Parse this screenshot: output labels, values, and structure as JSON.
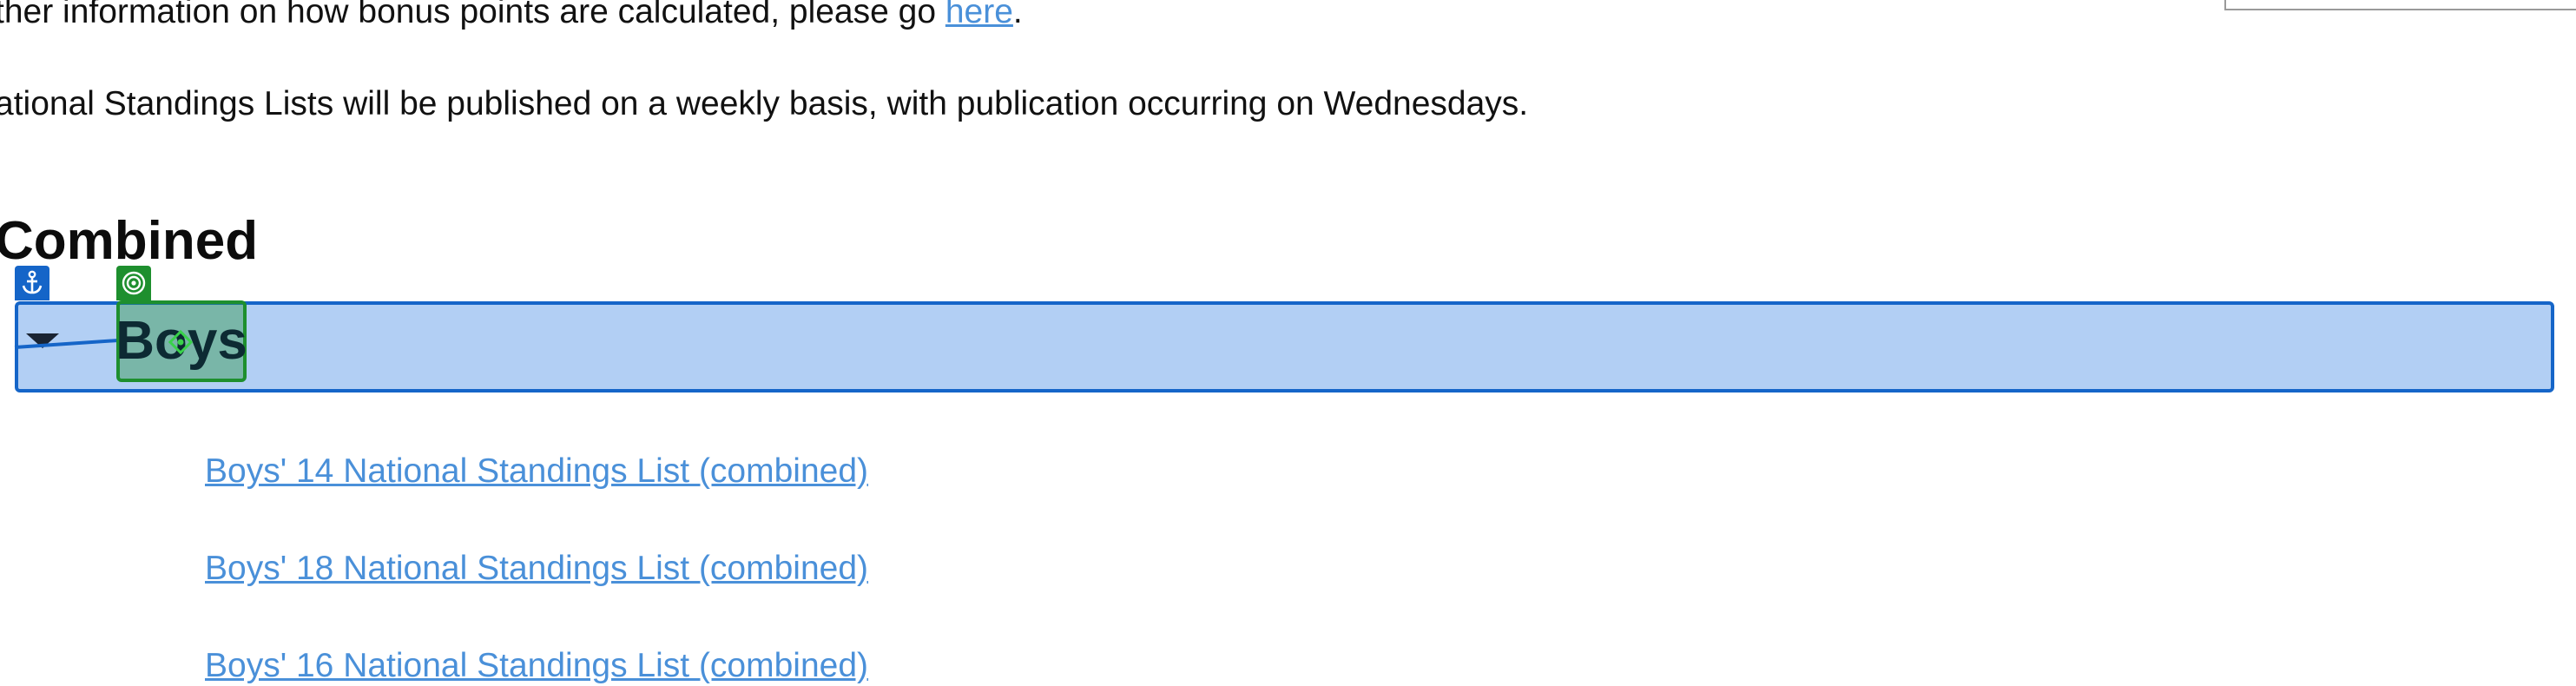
{
  "content": {
    "bonus_text": "ther information on how bonus points are calculated, please go ",
    "bonus_link": "here",
    "bonus_end": ".",
    "standings_text": "ational Standings Lists will be published on a weekly basis, with publication occurring on Wednesdays.",
    "section_title": "Combined",
    "accordion_label": "Boys",
    "links": [
      "Boys' 14 National Standings List (combined)",
      "Boys' 18 National Standings List (combined)",
      "Boys' 16 National Standings List (combined)"
    ]
  },
  "icons": {
    "anchor": "anchor-icon",
    "target": "target-icon",
    "caret": "caret-down-icon",
    "focus": "focus-diamond-icon"
  },
  "colors": {
    "link": "#4a90d9",
    "selection_fill": "#b2cff4",
    "selection_border": "#1565c8",
    "target_green": "#1e8f2e",
    "text": "#111111"
  }
}
